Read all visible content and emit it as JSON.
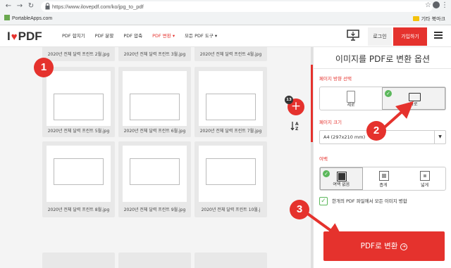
{
  "browser": {
    "url": "https://www.ilovepdf.com/ko/jpg_to_pdf",
    "bookmark_left": "PortableApps.com",
    "bookmark_right": "기타 북마크"
  },
  "header": {
    "logo_left": "I",
    "logo_right": "PDF",
    "nav": [
      "PDF 합치기",
      "PDF 분할",
      "PDF 압축",
      "PDF 변환 ▾",
      "모든 PDF 도구 ▾"
    ],
    "login": "로그인",
    "signup": "가입하기"
  },
  "workspace": {
    "files": [
      "2020년 전체 달력 프린트 2월.jpg",
      "2020년 전체 달력 프린트 3월.jpg",
      "2020년 전체 달력 프린트 4월.jpg",
      "2020년 전체 달력 프린트 5월.jpg",
      "2020년 전체 달력 프린트 6월.jpg",
      "2020년 전체 달력 프린트 7월.jpg",
      "2020년 전체 달력 프린트 8월.jpg",
      "2020년 전체 달력 프린트 9월.jpg",
      "2020년 전체 달력 프린트 10월.j"
    ],
    "file_count": "13",
    "sort_label": "↓A\nZ"
  },
  "annotations": [
    "1",
    "2",
    "3"
  ],
  "panel": {
    "title": "이미지를 PDF로 변환 옵션",
    "orientation_label": "페이지 방향 선택",
    "orientation_options": [
      "세로",
      "가로"
    ],
    "orientation_selected": "가로",
    "page_size_label": "페이지 크기",
    "page_size_value": "A4 (297x210 mm)",
    "margin_label": "여백",
    "margin_options": [
      "여백 없음",
      "좁게",
      "넓게"
    ],
    "margin_selected": "여백 없음",
    "merge_label": "한개의 PDF 파일에서 모든 이미지 병합",
    "merge_checked": true,
    "convert_button": "PDF로 변환"
  },
  "colors": {
    "accent": "#e5322d",
    "check": "#5cb85c"
  }
}
